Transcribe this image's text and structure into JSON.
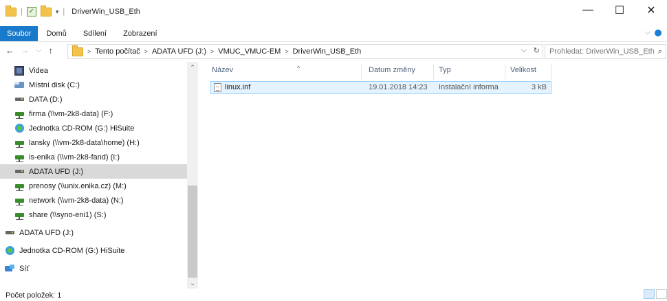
{
  "window": {
    "title": "DriverWin_USB_Eth",
    "minimize_glyph": "—",
    "maximize_glyph": "☐",
    "close_glyph": "✕"
  },
  "ribbon": {
    "tabs": [
      "Soubor",
      "Domů",
      "Sdílení",
      "Zobrazení"
    ],
    "expand_glyph": "⌵"
  },
  "address": {
    "back_glyph": "←",
    "forward_glyph": "→",
    "recent_glyph": "⌵",
    "up_glyph": "↑",
    "segments": [
      "Tento počítač",
      "ADATA UFD (J:)",
      "VMUC_VMUC-EM",
      "DriverWin_USB_Eth"
    ],
    "dropdown_glyph": "⌵",
    "refresh_glyph": "↻"
  },
  "search": {
    "placeholder": "Prohledat: DriverWin_USB_Eth",
    "icon_glyph": "⌕"
  },
  "navpane": {
    "items": [
      {
        "label": "Videa",
        "icon": "video-icon"
      },
      {
        "label": "Místní disk (C:)",
        "icon": "system-drive-icon"
      },
      {
        "label": "DATA (D:)",
        "icon": "drive-icon"
      },
      {
        "label": "firma (\\\\vm-2k8-data) (F:)",
        "icon": "network-drive-icon"
      },
      {
        "label": "Jednotka CD-ROM (G:) HiSuite",
        "icon": "cd-drive-icon"
      },
      {
        "label": "lansky (\\\\vm-2k8-data\\home) (H:)",
        "icon": "network-drive-icon"
      },
      {
        "label": "is-enika (\\\\vm-2k8-fand) (I:)",
        "icon": "network-drive-icon"
      },
      {
        "label": "ADATA UFD (J:)",
        "icon": "drive-icon",
        "selected": true
      },
      {
        "label": "prenosy (\\\\unix.enika.cz) (M:)",
        "icon": "network-drive-icon"
      },
      {
        "label": "network (\\\\vm-2k8-data) (N:)",
        "icon": "network-drive-icon"
      },
      {
        "label": "share (\\\\syno-eni1) (S:)",
        "icon": "network-drive-icon"
      },
      {
        "label": "ADATA UFD (J:)",
        "icon": "drive-icon"
      },
      {
        "label": "Jednotka CD-ROM (G:) HiSuite",
        "icon": "cd-drive-icon"
      },
      {
        "label": "Síť",
        "icon": "network-icon"
      }
    ],
    "scroll_up_glyph": "⌃",
    "scroll_down_glyph": "⌄"
  },
  "columns": {
    "name": "Název",
    "date": "Datum změny",
    "type": "Typ",
    "size": "Velikost"
  },
  "files": [
    {
      "name": "linux.inf",
      "date": "19.01.2018 14:23",
      "type": "Instalační informa",
      "size": "3 kB"
    }
  ],
  "status": {
    "item_count": "Počet položek: 1"
  },
  "colors": {
    "accent": "#1979ca",
    "selection": "#e5f3ff",
    "selection_border": "#99d1ff"
  }
}
